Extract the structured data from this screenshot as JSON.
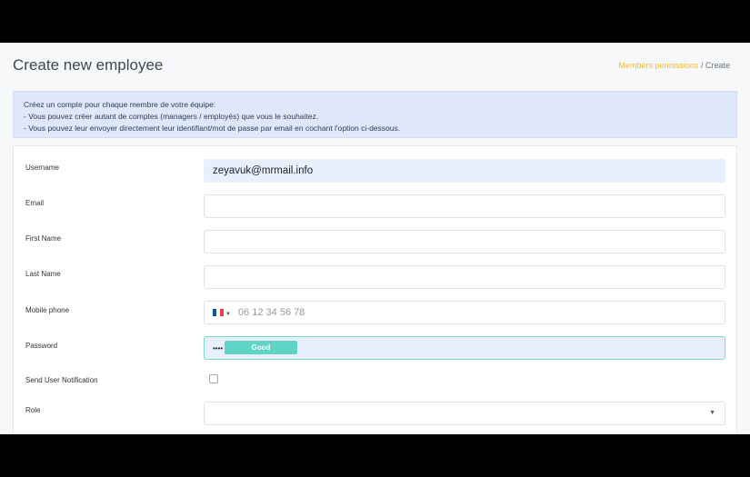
{
  "header": {
    "title": "Create new employee",
    "breadcrumb": {
      "link": "Members permissions",
      "sep": "/",
      "current": "Create"
    }
  },
  "info": {
    "lines": [
      "Créez un compte pour chaque membre de votre équipe:",
      "- Vous pouvez créer autant de comptes (managers / employés) que vous le souhaitez.",
      "- Vous pouvez leur envoyer directement leur identifiant/mot de passe par email en cochant l'option ci-dessous."
    ]
  },
  "form": {
    "username_label": "Username",
    "username_value": "zeyavuk@mrmail.info",
    "email_label": "Email",
    "first_name_label": "First Name",
    "last_name_label": "Last Name",
    "mobile_label": "Mobile phone",
    "mobile_placeholder": "06 12 34 56 78",
    "password_label": "Password",
    "password_mask": "••••",
    "password_strength": "Good",
    "notify_label": "Send User Notification",
    "role_label": "Role"
  }
}
